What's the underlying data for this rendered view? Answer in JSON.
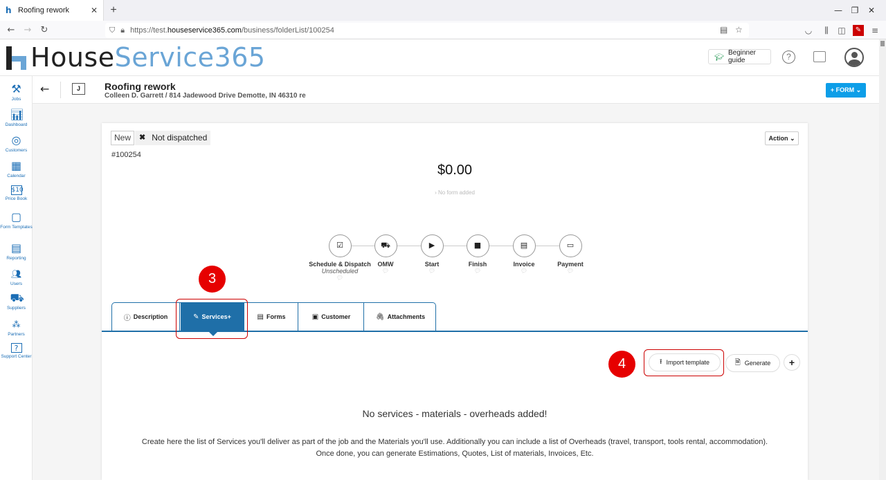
{
  "browser": {
    "tab_title": "Roofing rework",
    "url_prefix": "https://test.",
    "url_domain": "houseservice365.com",
    "url_path": "/business/folderList/100254"
  },
  "header": {
    "logo_part1": "House",
    "logo_part2": "Service365",
    "beginner_guide": "Beginner guide"
  },
  "sidebar": {
    "items": [
      {
        "label": "Jobs",
        "icon": "tools-icon"
      },
      {
        "label": "Dashboard",
        "icon": "chart-icon"
      },
      {
        "label": "Customers",
        "icon": "target-icon"
      },
      {
        "label": "Calendar",
        "icon": "calendar-icon"
      },
      {
        "label": "Price Book",
        "icon": "price-tag-icon"
      },
      {
        "label": "Form Templates",
        "icon": "form-icon"
      },
      {
        "label": "Reporting",
        "icon": "report-icon"
      },
      {
        "label": "Users",
        "icon": "users-icon"
      },
      {
        "label": "Suppliers",
        "icon": "truck-icon"
      },
      {
        "label": "Partners",
        "icon": "network-icon"
      },
      {
        "label": "Support Center",
        "icon": "help-icon"
      }
    ]
  },
  "job": {
    "badge": "J",
    "title": "Roofing rework",
    "subtitle": "Colleen D. Garrett / 814 Jadewood Drive Demotte, IN 46310 re",
    "form_button": "+ FORM ⌄"
  },
  "card": {
    "status_new": "New",
    "status_dispatch": "Not dispatched",
    "job_id": "#100254",
    "action": "Action ⌄",
    "amount": "$0.00",
    "no_form": "› No form added",
    "steps": [
      {
        "label": "Schedule & Dispatch",
        "sub": "Unscheduled",
        "icon": "calendar-check-icon"
      },
      {
        "label": "OMW",
        "sub": "",
        "icon": "truck-icon"
      },
      {
        "label": "Start",
        "sub": "",
        "icon": "play-icon"
      },
      {
        "label": "Finish",
        "sub": "",
        "icon": "stop-icon"
      },
      {
        "label": "Invoice",
        "sub": "",
        "icon": "document-icon"
      },
      {
        "label": "Payment",
        "sub": "",
        "icon": "card-icon"
      }
    ],
    "tabs": [
      {
        "label": "Description",
        "icon": "info-icon"
      },
      {
        "label": "Services+",
        "icon": "wrench-icon"
      },
      {
        "label": "Forms",
        "icon": "document-icon"
      },
      {
        "label": "Customer",
        "icon": "id-card-icon"
      },
      {
        "label": "Attachments",
        "icon": "paperclip-icon"
      }
    ],
    "annotation_3": "3",
    "annotation_4": "4",
    "import_template": "Import template",
    "generate": "Generate",
    "empty_title": "No services - materials - overheads added!",
    "empty_desc_1": "Create here the list of Services you'll deliver as part of the job and the Materials you'll use. Additionally you can include a list of Overheads (travel, transport, tools rental, accommodation).",
    "empty_desc_2": "Once done, you can generate Estimations, Quotes, List of materials, Invoices, Etc."
  },
  "colors": {
    "brand_blue": "#1a6db5",
    "tab_active": "#1f6fa8",
    "form_button": "#0d9ee8",
    "annotation_red": "#e60000"
  }
}
